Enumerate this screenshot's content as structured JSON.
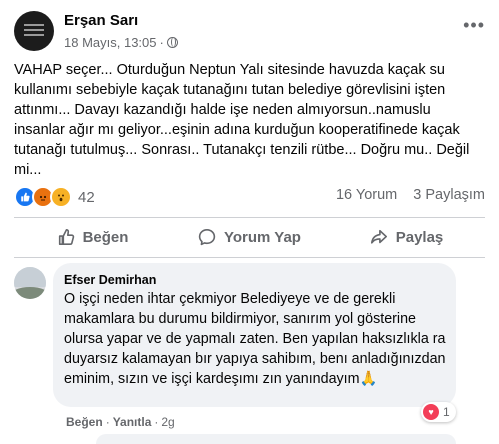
{
  "post": {
    "author": "Erşan Sarı",
    "date": "18 Mayıs, 13:05",
    "dot": "·",
    "text": "VAHAP seçer... Oturduğun Neptun Yalı sitesinde havuzda kaçak su kullanımı sebebiyle kaçak tutanağını tutan belediye görevlisini işten attınmı... Davayı kazandığı halde işe neden almıyorsun..namuslu insanlar ağır mı geliyor...eşinin adına kurduğun kooperatifinede kaçak tutanağı tutulmuş... Sonrası.. Tutanakçı tenzili rütbe... Doğru mu.. Değil mi...",
    "reaction_count": "42",
    "comments": "16 Yorum",
    "shares": "3 Paylaşım"
  },
  "actions": {
    "like": "Beğen",
    "comment": "Yorum Yap",
    "share": "Paylaş"
  },
  "comment": {
    "author": "Efser Demirhan",
    "text": "O işçi neden ihtar çekmiyor Belediyeye ve de gerekli makamlara bu durumu bildirmiyor, sanırım yol gösterine olursa yapar ve de yapmalı zaten. Ben yapılan haksızlıkla ra duyarsız kalamayan bır yapıya sahibım, benı anladığınızdan eminim, sızın ve işçi kardeşımı zın yanındayım🙏",
    "like_link": "Beğen",
    "reply_link": "Yanıtla",
    "time": "2g",
    "reaction_count": "1"
  },
  "icons": [
    "globe-icon",
    "more-icon",
    "like-icon",
    "comment-icon",
    "share-icon",
    "heart-icon"
  ],
  "colors": {
    "like": "#1877f2",
    "angry": "#e9710f",
    "wow": "#f7b125",
    "heart": "#f33e58",
    "muted": "#65676b"
  }
}
